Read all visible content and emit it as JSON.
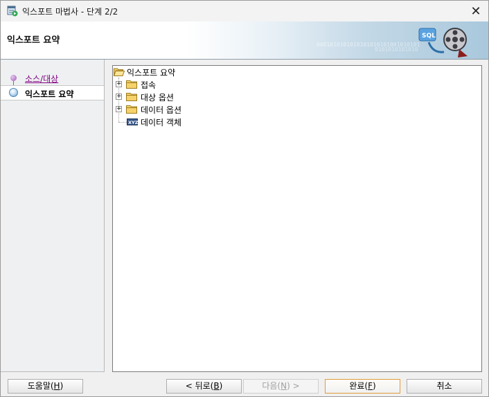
{
  "window": {
    "title": "익스포트 마법사 - 단계 2/2",
    "close_glyph": "✕"
  },
  "banner": {
    "title": "익스포트 요약",
    "art_icon": "sql-export-film-icon",
    "art_text": "SQL",
    "binary_text_1": "0001010101010101010101001010101",
    "binary_text_2": "0101010101010"
  },
  "nav": {
    "items": [
      {
        "label": "소스/대상",
        "state": "visited"
      },
      {
        "label": "익스포트 요약",
        "state": "active"
      }
    ]
  },
  "tree": {
    "root": "익스포트 요약",
    "children": [
      {
        "label": "접속",
        "type": "folder",
        "expandable": true,
        "expander": "+"
      },
      {
        "label": "대상 옵션",
        "type": "folder",
        "expandable": true,
        "expander": "+"
      },
      {
        "label": "데이터 옵션",
        "type": "folder",
        "expandable": true,
        "expander": "+"
      },
      {
        "label": "데이터 객체",
        "type": "xyz-item",
        "expandable": false,
        "badge": "XYZ"
      }
    ]
  },
  "buttons": {
    "help": {
      "label": "도움말(",
      "mnemonic": "H",
      "suffix": ")"
    },
    "back": {
      "label": "< 뒤로(",
      "mnemonic": "B",
      "suffix": ")"
    },
    "next": {
      "label": "다음(",
      "mnemonic": "N",
      "suffix": ") >"
    },
    "finish": {
      "label": "완료(",
      "mnemonic": "F",
      "suffix": ")"
    },
    "cancel": {
      "label": "취소"
    }
  },
  "colors": {
    "visited_link": "#800080",
    "default_button_border": "#e09a3a",
    "folder": "#f5d26b"
  }
}
